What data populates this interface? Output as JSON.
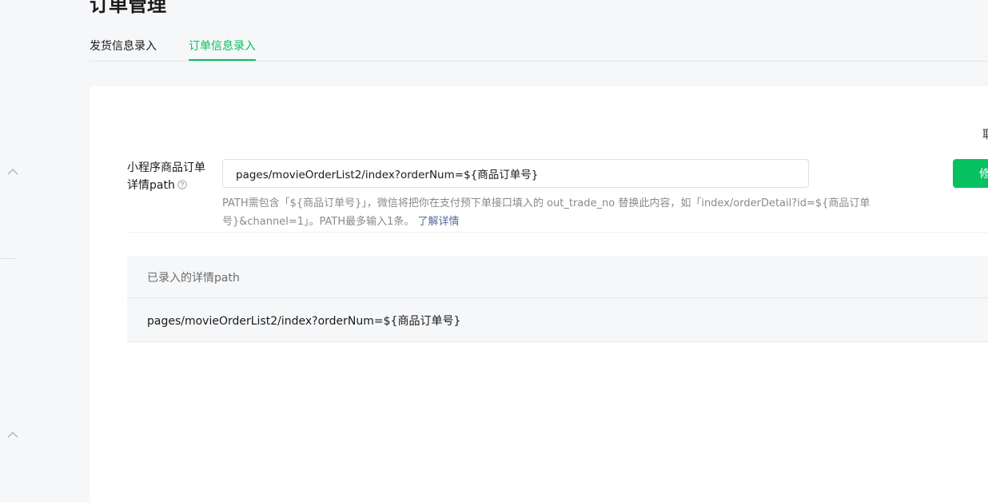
{
  "page": {
    "title": "订单管理"
  },
  "tabs": [
    {
      "label": "发货信息录入",
      "active": false
    },
    {
      "label": "订单信息录入",
      "active": true
    }
  ],
  "card": {
    "corner_text": "取"
  },
  "form": {
    "label": "小程序商品订单详情path",
    "input_value": "pages/movieOrderList2/index?orderNum=${商品订单号}",
    "hint_text": "PATH需包含「${商品订单号}」，微信将把你在支付预下单接口填入的 out_trade_no 替换此内容，如「index/orderDetail?id=${商品订单号}&channel=1」。PATH最多输入1条。",
    "hint_link": "了解详情",
    "edit_button": "修改"
  },
  "table": {
    "header": "已录入的详情path",
    "rows": [
      {
        "path": "pages/movieOrderList2/index?orderNum=${商品订单号}"
      }
    ]
  },
  "colors": {
    "accent": "#07c160",
    "link": "#576b95",
    "background": "#f6f7f9"
  },
  "icons": {
    "help": "help-circle-icon",
    "chevron": "chevron-up-icon"
  }
}
